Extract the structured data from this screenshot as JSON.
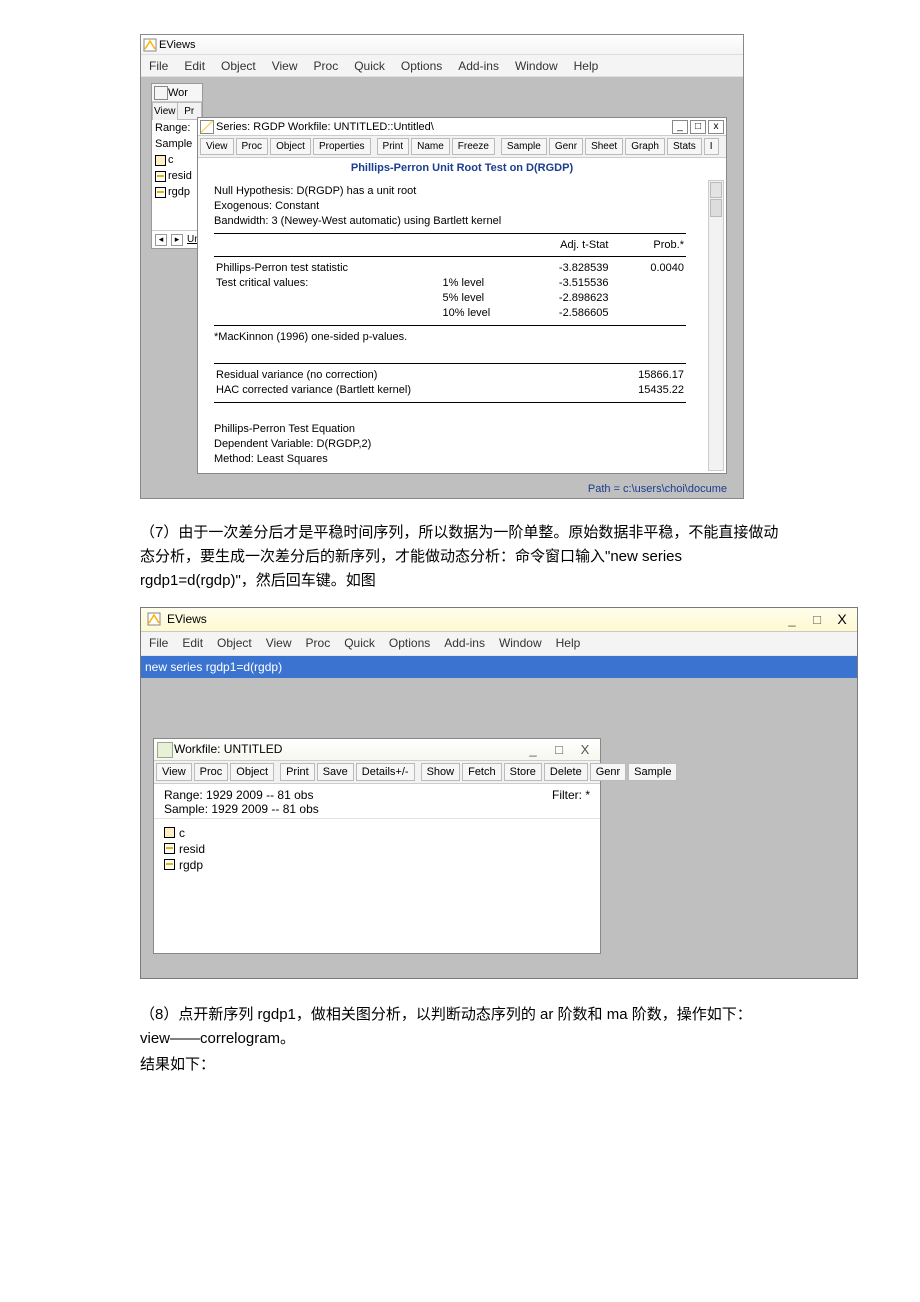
{
  "win1": {
    "app_title": "EViews",
    "menu": [
      "File",
      "Edit",
      "Object",
      "View",
      "Proc",
      "Quick",
      "Options",
      "Add-ins",
      "Window",
      "Help"
    ],
    "side": {
      "title": "Wor",
      "btn1": "View",
      "btn2": "Pr",
      "r1": "Range:",
      "r2": "Sample",
      "items": [
        "c",
        "resid",
        "rgdp"
      ],
      "foot": "Un"
    },
    "inner": {
      "title": "Series: RGDP   Workfile: UNTITLED::Untitled\\",
      "win_min": "_",
      "win_max": "□",
      "win_close": "x",
      "toolbar": [
        "View",
        "Proc",
        "Object",
        "Properties",
        "Print",
        "Name",
        "Freeze",
        "Sample",
        "Genr",
        "Sheet",
        "Graph",
        "Stats",
        "I"
      ],
      "test_title": "Phillips-Perron Unit Root Test on D(RGDP)",
      "hyp1": "Null Hypothesis: D(RGDP) has a unit root",
      "hyp2": "Exogenous: Constant",
      "hyp3": "Bandwidth: 3 (Newey-West automatic) using Bartlett kernel",
      "h_adj": "Adj. t-Stat",
      "h_prob": "Prob.*",
      "row_pp": "Phillips-Perron test statistic",
      "row_cv": "Test critical values:",
      "lv1": "1% level",
      "lv5": "5% level",
      "lv10": "10% level",
      "v_pp": "-3.828539",
      "v_prob": "0.0040",
      "v_1": "-3.515536",
      "v_5": "-2.898623",
      "v_10": "-2.586605",
      "mac": "*MacKinnon (1996) one-sided p-values.",
      "res1": "Residual variance (no correction)",
      "res2": "HAC corrected variance (Bartlett kernel)",
      "rv1": "15866.17",
      "rv2": "15435.22",
      "eq1": "Phillips-Perron Test Equation",
      "eq2": "Dependent Variable: D(RGDP,2)",
      "eq3": "Method: Least Squares"
    },
    "status": "Path = c:\\users\\choi\\docume"
  },
  "doc": {
    "p1": "（7）由于一次差分后才是平稳时间序列，所以数据为一阶单整。原始数据非平稳，不能直接做动态分析，要生成一次差分后的新序列，才能做动态分析：命令窗口输入\"new series rgdp1=d(rgdp)\"，然后回车键。如图",
    "p2": "（8）点开新序列 rgdp1，做相关图分析，以判断动态序列的 ar 阶数和 ma 阶数，操作如下：view——correlogram。",
    "p3": "结果如下："
  },
  "win2": {
    "title": "EViews",
    "win_min": "_",
    "win_max": "□",
    "win_close": "X",
    "menu": [
      "File",
      "Edit",
      "Object",
      "View",
      "Proc",
      "Quick",
      "Options",
      "Add-ins",
      "Window",
      "Help"
    ],
    "command": "new series rgdp1=d(rgdp)",
    "wf": {
      "title": "Workfile: UNTITLED",
      "w_min": "_",
      "w_max": "□",
      "w_close": "X",
      "toolbar": [
        "View",
        "Proc",
        "Object",
        "Print",
        "Save",
        "Details+/-",
        "Show",
        "Fetch",
        "Store",
        "Delete",
        "Genr",
        "Sample"
      ],
      "range": "Range:  1929 2009   --   81 obs",
      "sample": "Sample: 1929 2009   --   81 obs",
      "filter": "Filter: *",
      "items": [
        "c",
        "resid",
        "rgdp"
      ]
    }
  }
}
